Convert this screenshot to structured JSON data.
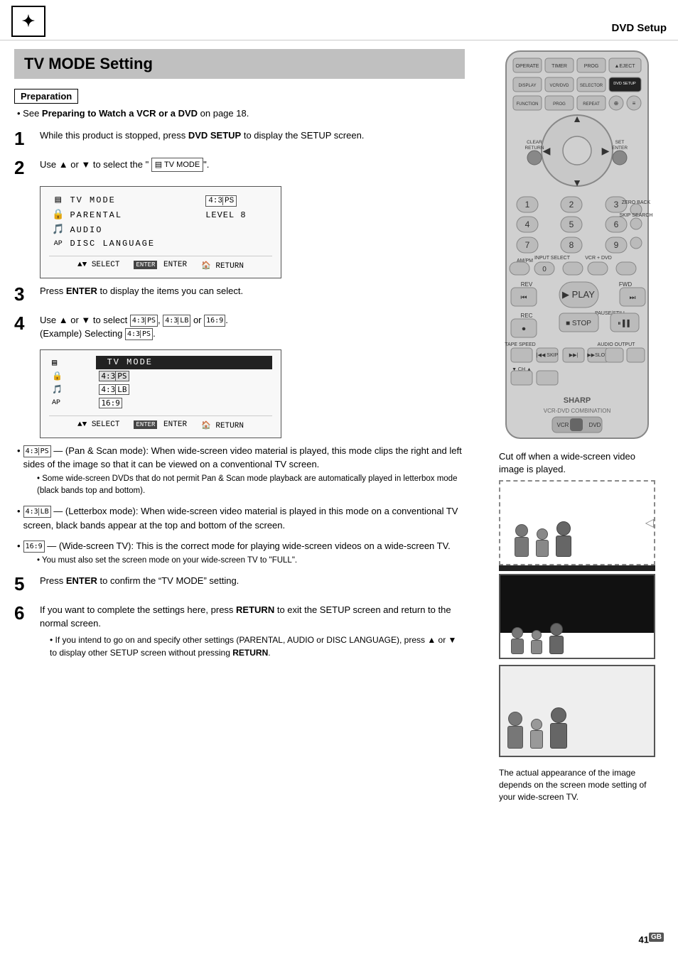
{
  "header": {
    "logo_symbol": "✦",
    "title": "DVD Setup"
  },
  "page_title": "TV MODE Setting",
  "preparation": {
    "label": "Preparation",
    "text": "See ",
    "bold_text": "Preparing to Watch a VCR or a DVD",
    "suffix": " on page 18."
  },
  "steps": [
    {
      "number": "1",
      "text_before": "While this product is stopped, press ",
      "bold": "DVD SETUP",
      "text_after": " to display the SETUP screen."
    },
    {
      "number": "2",
      "text_before": "Use ▲ or ▼ to select the “",
      "icon_label": "TV MODE",
      "text_after": "”."
    },
    {
      "number": "3",
      "text_before": "Press ",
      "bold": "ENTER",
      "text_after": " to display the items you can select."
    },
    {
      "number": "4",
      "text_before": "Use ▲ or ▼ to select ",
      "options": [
        "4:3 PS",
        "4:3 LB",
        "16:9"
      ],
      "example": "(Example) Selecting"
    },
    {
      "number": "5",
      "text_before": "Press ",
      "bold": "ENTER",
      "text_after": " to confirm the “TV MODE” setting."
    },
    {
      "number": "6",
      "text_before": "If you want to complete the settings here, press ",
      "bold": "RETURN",
      "text_after": " to exit the SETUP screen and return to the normal screen.",
      "sub": "If you intend to go on and specify other settings (PARENTAL, AUDIO or DISC LANGUAGE), press ▲ or ▼ to display other SETUP screen without pressing ",
      "sub_bold": "RETURN",
      "sub_end": "."
    }
  ],
  "setup_screen1": {
    "rows": [
      {
        "icon": "▤",
        "label": "TV MODE",
        "value": "4:3|PS",
        "highlighted": false
      },
      {
        "icon": "🔒",
        "label": "PARENTAL",
        "value": "LEVEL 8",
        "highlighted": false
      },
      {
        "icon": "🎵",
        "label": "AUDIO",
        "value": "",
        "highlighted": false
      },
      {
        "icon": "AP",
        "label": "DISC LANGUAGE",
        "value": "",
        "highlighted": false
      }
    ],
    "nav": {
      "select": "▲▼ SELECT",
      "enter_label": "ENTER",
      "enter": "ENTER",
      "return_label": "🏠 RETURN"
    }
  },
  "setup_screen2": {
    "title_row": "TV MODE",
    "rows": [
      {
        "label": "4:3 PS",
        "highlighted": true
      },
      {
        "label": "4:3 LB",
        "highlighted": false
      },
      {
        "label": "16:9",
        "highlighted": false
      }
    ],
    "nav": {
      "select": "▲▼ SELECT",
      "enter_label": "ENTER",
      "enter": "ENTER",
      "return_label": "🏠 RETURN"
    }
  },
  "mode_descriptions": [
    {
      "tag": "4:3|PS",
      "dash": "— (Pan & Scan mode): When wide-screen video material is played, this mode clips the right and left sides of the image so that it can be viewed on a conventional TV screen.",
      "sub": "Some wide-screen DVDs that do not permit Pan & Scan mode playback are automatically played in letterbox mode (black bands top and bottom)."
    },
    {
      "tag": "4:3|LB",
      "dash": "— (Letterbox mode): When wide-screen video material is played in this mode on a conventional TV screen, black bands appear at the top and bottom of the screen.",
      "sub": null
    },
    {
      "tag": "16:9",
      "dash": "— (Wide-screen TV): This is the correct mode for playing wide-screen videos on a wide-screen TV.",
      "sub": "You must also set the screen mode on your wide-screen TV to “FULL”."
    }
  ],
  "right_panel": {
    "cutoff_label": "Cut off when a wide-screen video image is played.",
    "actual_label": "The actual appearance of the image depends on the screen mode setting of your wide-screen TV."
  },
  "page_number": "41",
  "gb_badge": "GB"
}
